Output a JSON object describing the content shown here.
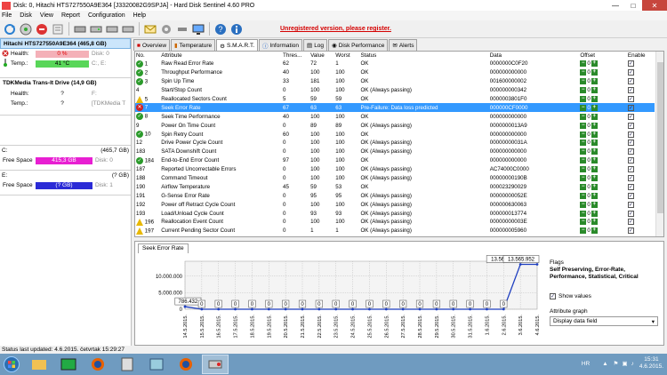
{
  "window": {
    "title": "Disk: 0, Hitachi HTS727550A9E364 [J3320082G9SPJA]  -  Hard Disk Sentinel 4.60 PRO"
  },
  "menu": [
    "File",
    "Disk",
    "View",
    "Report",
    "Configuration",
    "Help"
  ],
  "toolbar": {
    "unregistered_text": "Unregistered version, please register."
  },
  "disks": [
    {
      "name": "Hitachi HTS727550A9E364",
      "size": "(465,8 GB)",
      "health_label": "Health:",
      "health_value": "0 %",
      "temp_label": "Temp.:",
      "temp_value": "41 °C",
      "disk_index": "Disk: 0",
      "drive_letters": "C:, E:"
    },
    {
      "name": "TDKMedia Trans-It Drive",
      "size": "(14,9 GB)",
      "health_label": "Health:",
      "health_value": "?",
      "temp_label": "Temp.:",
      "temp_value": "?",
      "disk_index": "Disk: 1",
      "drive_letters": "F:",
      "model_short": "[TDKMedia T"
    }
  ],
  "volumes": [
    {
      "letter": "C:",
      "size": "(465,7 GB)",
      "free_label": "Free Space",
      "free_value": "415,3 GB",
      "disk": "Disk: 0",
      "fill": 0.89
    },
    {
      "letter": "E:",
      "size": "(? GB)",
      "free_label": "Free Space",
      "free_value": "(? GB)",
      "disk": "Disk: 1",
      "fill": 1.0
    }
  ],
  "tabs": [
    {
      "label": "Overview",
      "icon": "overview-icon"
    },
    {
      "label": "Temperature",
      "icon": "temperature-icon"
    },
    {
      "label": "S.M.A.R.T.",
      "icon": "smart-icon"
    },
    {
      "label": "Information",
      "icon": "info-icon"
    },
    {
      "label": "Log",
      "icon": "log-icon"
    },
    {
      "label": "Disk Performance",
      "icon": "performance-icon"
    },
    {
      "label": "Alerts",
      "icon": "alerts-icon"
    }
  ],
  "smart_table": {
    "columns": [
      "No.",
      "Attribute",
      "Thres...",
      "Value",
      "Worst",
      "Status",
      "Data",
      "Offset",
      "Enable"
    ],
    "rows": [
      {
        "s": "ok",
        "no": "1",
        "attr": "Raw Read Error Rate",
        "thr": "62",
        "val": "72",
        "worst": "1",
        "status": "OK",
        "data": "0000000C0F20"
      },
      {
        "s": "ok",
        "no": "2",
        "attr": "Throughput Performance",
        "thr": "40",
        "val": "100",
        "worst": "100",
        "status": "OK",
        "data": "000000000000"
      },
      {
        "s": "ok",
        "no": "3",
        "attr": "Spin Up Time",
        "thr": "33",
        "val": "181",
        "worst": "100",
        "status": "OK",
        "data": "001600000002"
      },
      {
        "s": "none",
        "no": "4",
        "attr": "Start/Stop Count",
        "thr": "0",
        "val": "100",
        "worst": "100",
        "status": "OK (Always passing)",
        "data": "000000000342"
      },
      {
        "s": "warn",
        "no": "5",
        "attr": "Reallocated Sectors Count",
        "thr": "5",
        "val": "59",
        "worst": "59",
        "status": "OK",
        "data": "0000003801F0"
      },
      {
        "s": "bad",
        "no": "7",
        "attr": "Seek Error Rate",
        "thr": "67",
        "val": "63",
        "worst": "63",
        "status": "Pre-Failure: Data loss predicted",
        "data": "000000CF0000",
        "sel": true
      },
      {
        "s": "ok",
        "no": "8",
        "attr": "Seek Time Performance",
        "thr": "40",
        "val": "100",
        "worst": "100",
        "status": "OK",
        "data": "000000000000"
      },
      {
        "s": "none",
        "no": "9",
        "attr": "Power On Time Count",
        "thr": "0",
        "val": "89",
        "worst": "89",
        "status": "OK (Always passing)",
        "data": "0000000013A9"
      },
      {
        "s": "ok",
        "no": "10",
        "attr": "Spin Retry Count",
        "thr": "60",
        "val": "100",
        "worst": "100",
        "status": "OK",
        "data": "000000000000"
      },
      {
        "s": "none",
        "no": "12",
        "attr": "Drive Power Cycle Count",
        "thr": "0",
        "val": "100",
        "worst": "100",
        "status": "OK (Always passing)",
        "data": "00000000031A"
      },
      {
        "s": "none",
        "no": "183",
        "attr": "SATA Downshift Count",
        "thr": "0",
        "val": "100",
        "worst": "100",
        "status": "OK (Always passing)",
        "data": "000000000000"
      },
      {
        "s": "ok",
        "no": "184",
        "attr": "End-to-End Error Count",
        "thr": "97",
        "val": "100",
        "worst": "100",
        "status": "OK",
        "data": "000000000000"
      },
      {
        "s": "none",
        "no": "187",
        "attr": "Reported Uncorrectable Errors",
        "thr": "0",
        "val": "100",
        "worst": "100",
        "status": "OK (Always passing)",
        "data": "AC74000C0000"
      },
      {
        "s": "none",
        "no": "188",
        "attr": "Command Timeout",
        "thr": "0",
        "val": "100",
        "worst": "100",
        "status": "OK (Always passing)",
        "data": "00000000190B"
      },
      {
        "s": "none",
        "no": "190",
        "attr": "Airflow Temperature",
        "thr": "45",
        "val": "59",
        "worst": "53",
        "status": "OK",
        "data": "000023290029"
      },
      {
        "s": "none",
        "no": "191",
        "attr": "G-Sense Error Rate",
        "thr": "0",
        "val": "95",
        "worst": "95",
        "status": "OK (Always passing)",
        "data": "00000000052E"
      },
      {
        "s": "none",
        "no": "192",
        "attr": "Power off Retract Cycle Count",
        "thr": "0",
        "val": "100",
        "worst": "100",
        "status": "OK (Always passing)",
        "data": "000000630063"
      },
      {
        "s": "none",
        "no": "193",
        "attr": "Load/Unload Cycle Count",
        "thr": "0",
        "val": "93",
        "worst": "93",
        "status": "OK (Always passing)",
        "data": "000000013774"
      },
      {
        "s": "warn",
        "no": "196",
        "attr": "Reallocation Event Count",
        "thr": "0",
        "val": "100",
        "worst": "100",
        "status": "OK (Always passing)",
        "data": "00000000003E"
      },
      {
        "s": "warn",
        "no": "197",
        "attr": "Current Pending Sector Count",
        "thr": "0",
        "val": "1",
        "worst": "1",
        "status": "OK (Always passing)",
        "data": "000000005960"
      }
    ],
    "offset_value": "0"
  },
  "graph": {
    "tab_label": "Seek Error Rate",
    "flags_label": "Flags",
    "flags_text": "Self Preserving, Error-Rate, Performance, Statistical, Critical",
    "show_values_label": "Show values",
    "attribute_graph_label": "Attribute graph",
    "attribute_graph_value": "Display data field"
  },
  "chart_data": {
    "type": "line",
    "title": "",
    "xlabel": "",
    "ylabel": "",
    "categories": [
      "14.5.2015.",
      "15.5.2015.",
      "16.5.2015.",
      "17.5.2015.",
      "18.5.2015.",
      "19.5.2015.",
      "20.5.2015.",
      "21.5.2015.",
      "22.5.2015.",
      "23.5.2015.",
      "24.5.2015.",
      "25.5.2015.",
      "26.5.2015.",
      "27.5.2015.",
      "28.5.2015.",
      "29.5.2015.",
      "30.5.2015.",
      "31.5.2015.",
      "1.6.2015.",
      "2.6.2015.",
      "3.6.2015.",
      "4.6.2015."
    ],
    "values": [
      786432,
      0,
      0,
      0,
      0,
      0,
      0,
      0,
      0,
      0,
      0,
      0,
      0,
      0,
      0,
      0,
      0,
      0,
      0,
      0,
      13565952,
      13565952
    ],
    "value_labels": [
      "786.432",
      "0",
      "0",
      "0",
      "0",
      "0",
      "0",
      "0",
      "0",
      "0",
      "0",
      "0",
      "0",
      "0",
      "0",
      "0",
      "0",
      "0",
      "0",
      "0",
      "13.565.952",
      "13.565.952"
    ],
    "ytick_labels": [
      "0",
      "5.000.000",
      "10.000.000"
    ],
    "ylim": [
      0,
      14500000
    ],
    "grid": true
  },
  "status": {
    "text": "Status last updated: 4.6.2015. četvrtak 15:29:27"
  },
  "taskbar": {
    "lang": "HR",
    "time": "15:31",
    "date": "4.6.2015."
  },
  "colors": {
    "health_bar": "#f4b0b8",
    "temp_bar": "#59d659",
    "free_bar": "#e81fd2",
    "free_bar_unknown": "#2b2bd6",
    "selected_row": "#3399ff",
    "unregistered": "#d40000"
  }
}
